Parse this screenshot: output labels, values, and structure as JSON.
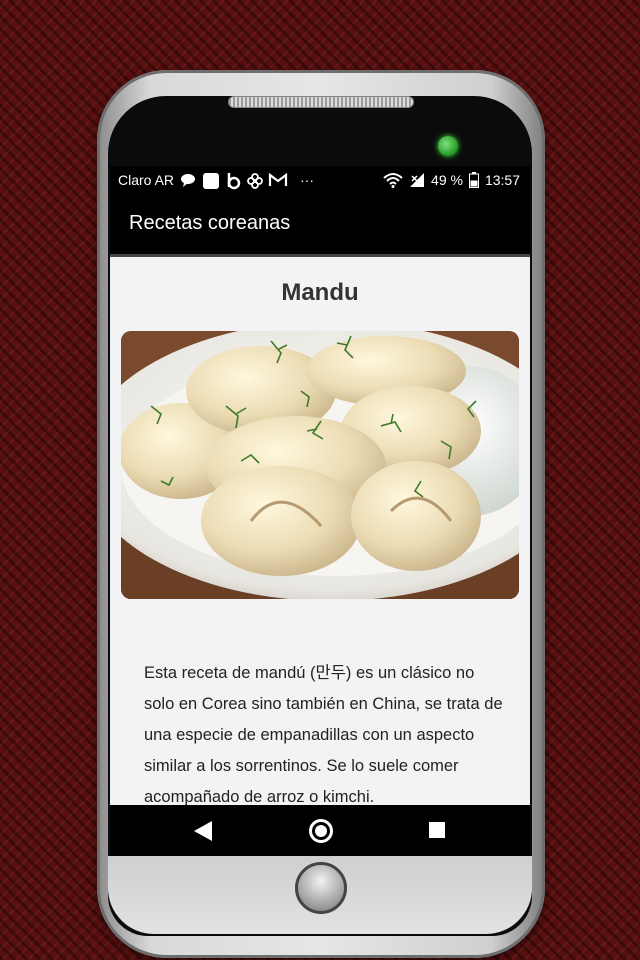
{
  "status_bar": {
    "carrier": "Claro AR",
    "more_indicator": "···",
    "battery_percent": "49 %",
    "time": "13:57",
    "icons": [
      "chat-bubble-icon",
      "square-app-icon",
      "b-app-icon",
      "pinwheel-icon",
      "gmail-icon",
      "wifi-icon",
      "signal-icon"
    ]
  },
  "app_bar": {
    "title": "Recetas coreanas"
  },
  "recipe": {
    "title": "Mandu",
    "description": "Esta receta de mandú (만두) es un clásico no solo en Corea sino también en China, se trata de una especie de empanadillas con un aspecto similar a los sorrentinos. Se lo suele comer acompañado de arroz o kimchi."
  },
  "nav_bar": {
    "icons": [
      "back-icon",
      "home-icon",
      "recents-icon"
    ]
  },
  "colors": {
    "background": "#5a0f0f",
    "screen": "#f3f3f6",
    "bars": "#000000"
  }
}
